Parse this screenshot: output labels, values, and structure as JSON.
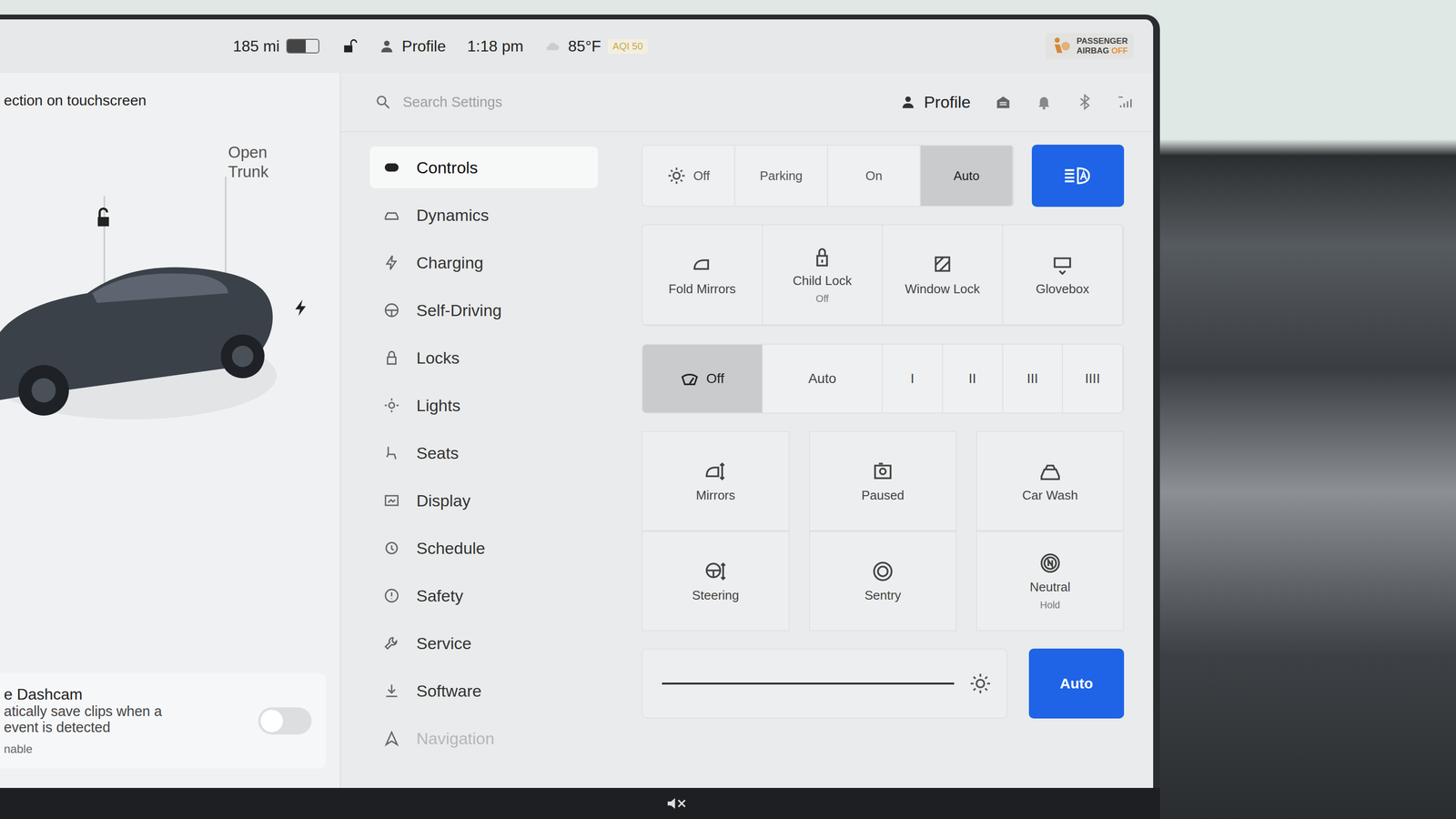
{
  "status_bar": {
    "range": "185 mi",
    "battery_level": 0.6,
    "profile": "Profile",
    "time": "1:18 pm",
    "temperature": "85°F",
    "aqi": "AQI 50",
    "airbag_lines": [
      "PASSENGER",
      "AIRBAG"
    ],
    "airbag_state": "OFF"
  },
  "car_panel": {
    "hint": "ection on touchscreen",
    "trunk": "Open Trunk",
    "charging": true
  },
  "dashcam": {
    "title": "e Dashcam",
    "lines": [
      "atically save clips when a",
      "event is detected"
    ],
    "action": "nable",
    "on": false
  },
  "settings_header": {
    "search_placeholder": "Search Settings",
    "profile": "Profile"
  },
  "menu": [
    {
      "label": "Controls",
      "selected": true,
      "faded": false
    },
    {
      "label": "Dynamics",
      "selected": false,
      "faded": false
    },
    {
      "label": "Charging",
      "selected": false,
      "faded": false
    },
    {
      "label": "Self-Driving",
      "selected": false,
      "faded": false
    },
    {
      "label": "Locks",
      "selected": false,
      "faded": false
    },
    {
      "label": "Lights",
      "selected": false,
      "faded": false
    },
    {
      "label": "Seats",
      "selected": false,
      "faded": false
    },
    {
      "label": "Display",
      "selected": false,
      "faded": false
    },
    {
      "label": "Schedule",
      "selected": false,
      "faded": false
    },
    {
      "label": "Safety",
      "selected": false,
      "faded": false
    },
    {
      "label": "Service",
      "selected": false,
      "faded": false
    },
    {
      "label": "Software",
      "selected": false,
      "faded": false
    },
    {
      "label": "Navigation",
      "selected": false,
      "faded": true
    }
  ],
  "headlights": [
    {
      "label": "Off",
      "selected": false
    },
    {
      "label": "Parking",
      "selected": false
    },
    {
      "label": "On",
      "selected": false
    },
    {
      "label": "Auto",
      "selected": true
    }
  ],
  "auto_high_beam": {
    "on": true
  },
  "control_tiles": [
    {
      "label": "Fold Mirrors",
      "sub": ""
    },
    {
      "label": "Child Lock",
      "sub": "Off"
    },
    {
      "label": "Window Lock",
      "sub": ""
    },
    {
      "label": "Glovebox",
      "sub": ""
    }
  ],
  "wipers": [
    {
      "label": "Off",
      "selected": true
    },
    {
      "label": "Auto",
      "selected": false
    },
    {
      "label": "I",
      "selected": false
    },
    {
      "label": "II",
      "selected": false
    },
    {
      "label": "III",
      "selected": false
    },
    {
      "label": "IIII",
      "selected": false
    }
  ],
  "quick_tiles": [
    {
      "label": "Mirrors",
      "sub": ""
    },
    {
      "label": "Paused",
      "sub": ""
    },
    {
      "label": "Car Wash",
      "sub": ""
    },
    {
      "label": "Steering",
      "sub": ""
    },
    {
      "label": "Sentry",
      "sub": ""
    },
    {
      "label": "Neutral",
      "sub": "Hold"
    }
  ],
  "brightness": {
    "level": 1,
    "auto_label": "Auto",
    "auto_on": true
  }
}
